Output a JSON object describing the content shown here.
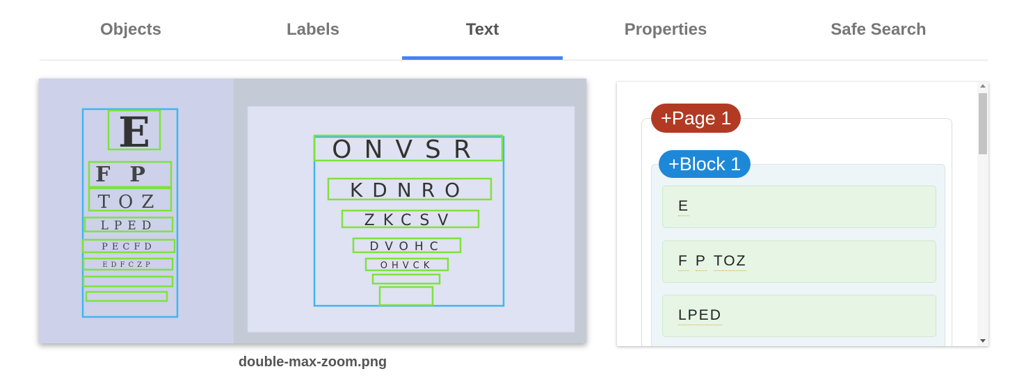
{
  "tabs": [
    {
      "label": "Objects"
    },
    {
      "label": "Labels"
    },
    {
      "label": "Text"
    },
    {
      "label": "Properties"
    },
    {
      "label": "Safe Search"
    }
  ],
  "active_tab": "Text",
  "colors": {
    "tab_indicator": "#4285f4",
    "page_pill": "#b23a23",
    "block_pill": "#1e88d8",
    "paragraph_bg": "#e6f5e4",
    "block_bg": "#edf5f9"
  },
  "image": {
    "filename": "double-max-zoom.png",
    "description_icon": "eye-chart-photo"
  },
  "results": {
    "page_label": "+Page 1",
    "block_label": "+Block 1",
    "paragraphs": [
      {
        "words": [
          "E"
        ]
      },
      {
        "words": [
          "F",
          "P",
          "TOZ"
        ]
      },
      {
        "words": [
          "LPED"
        ]
      }
    ]
  }
}
